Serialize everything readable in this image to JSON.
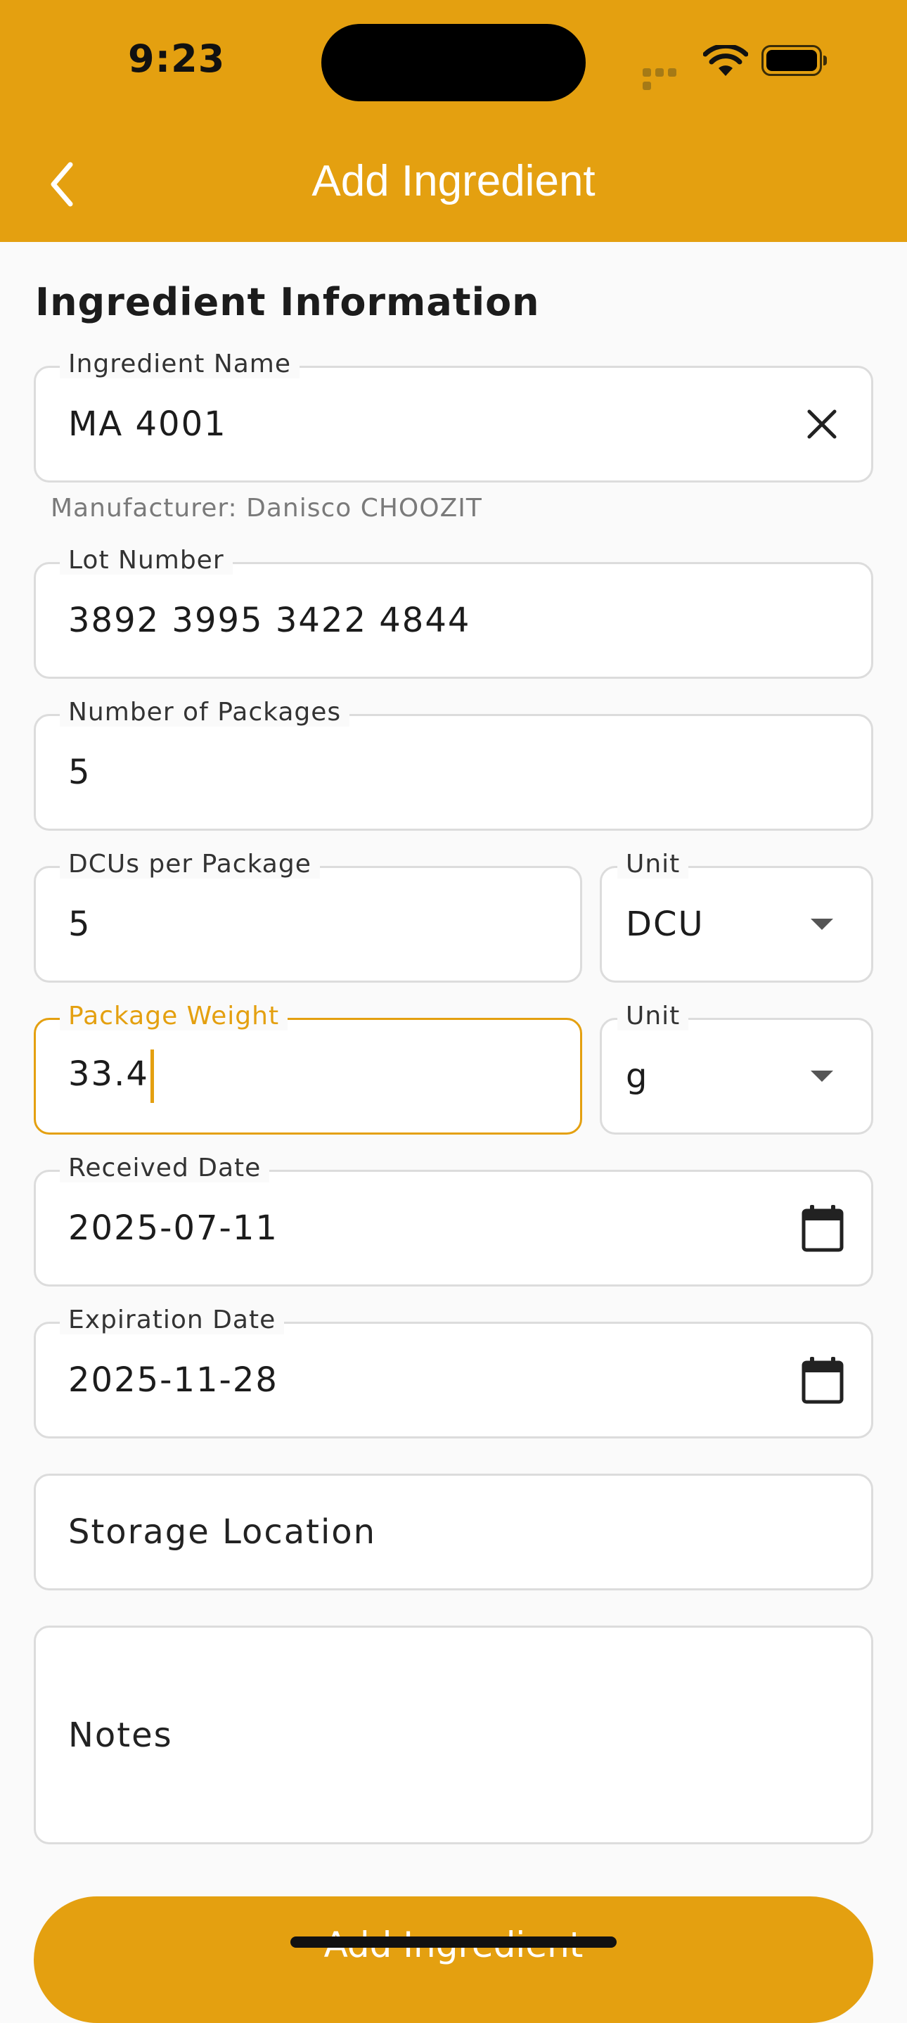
{
  "status_bar": {
    "time": "9:23"
  },
  "nav": {
    "title": "Add Ingredient"
  },
  "section": {
    "title": "Ingredient Information"
  },
  "fields": {
    "ingredient_name": {
      "label": "Ingredient Name",
      "value": "MA 4001",
      "helper": "Manufacturer: Danisco CHOOZIT"
    },
    "lot_number": {
      "label": "Lot Number",
      "value": "3892 3995 3422 4844"
    },
    "num_packages": {
      "label": "Number of Packages",
      "value": "5"
    },
    "dcus_per_package": {
      "label": "DCUs per Package",
      "value": "5"
    },
    "dcu_unit": {
      "label": "Unit",
      "value": "DCU"
    },
    "package_weight": {
      "label": "Package Weight",
      "value": "33.4"
    },
    "weight_unit": {
      "label": "Unit",
      "value": "g"
    },
    "received_date": {
      "label": "Received Date",
      "value": "2025-07-11"
    },
    "expiration_date": {
      "label": "Expiration Date",
      "value": "2025-11-28"
    },
    "storage_location": {
      "placeholder": "Storage Location"
    },
    "notes": {
      "placeholder": "Notes"
    }
  },
  "actions": {
    "submit_label": "Add Ingredient"
  },
  "colors": {
    "accent": "#e4a010",
    "background": "#fafafa",
    "border": "#dcdcdc"
  }
}
